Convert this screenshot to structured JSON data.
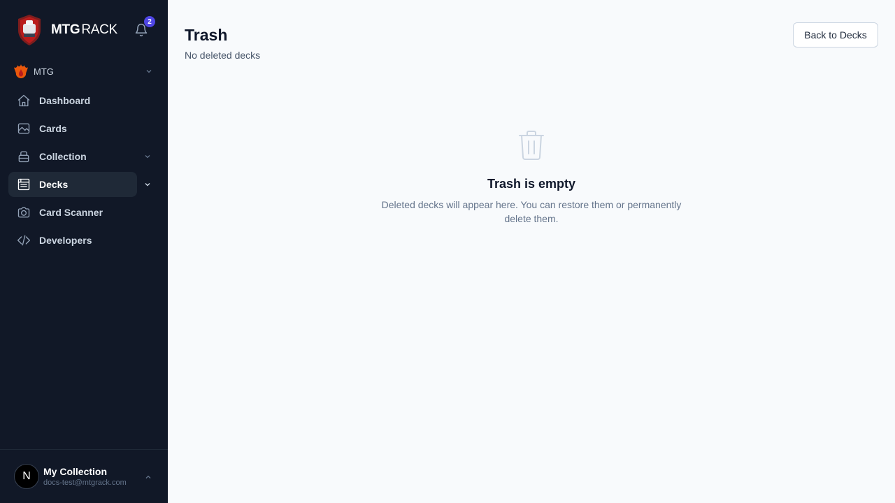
{
  "brand": {
    "bold": "MTG",
    "light": "RACK"
  },
  "notifications": {
    "count": "2"
  },
  "game_selector": {
    "label": "MTG"
  },
  "nav": {
    "dashboard": "Dashboard",
    "cards": "Cards",
    "collection": "Collection",
    "decks": "Decks",
    "card_scanner": "Card Scanner",
    "developers": "Developers"
  },
  "user": {
    "initial": "N",
    "name": "My Collection",
    "email": "docs-test@mtgrack.com"
  },
  "page": {
    "title": "Trash",
    "subtitle": "No deleted decks",
    "back_button": "Back to Decks"
  },
  "empty_state": {
    "title": "Trash is empty",
    "text": "Deleted decks will appear here. You can restore them or permanently delete them."
  },
  "colors": {
    "sidebar_bg": "#111827",
    "accent": "#4f46e5",
    "main_bg": "#f8fafc"
  }
}
